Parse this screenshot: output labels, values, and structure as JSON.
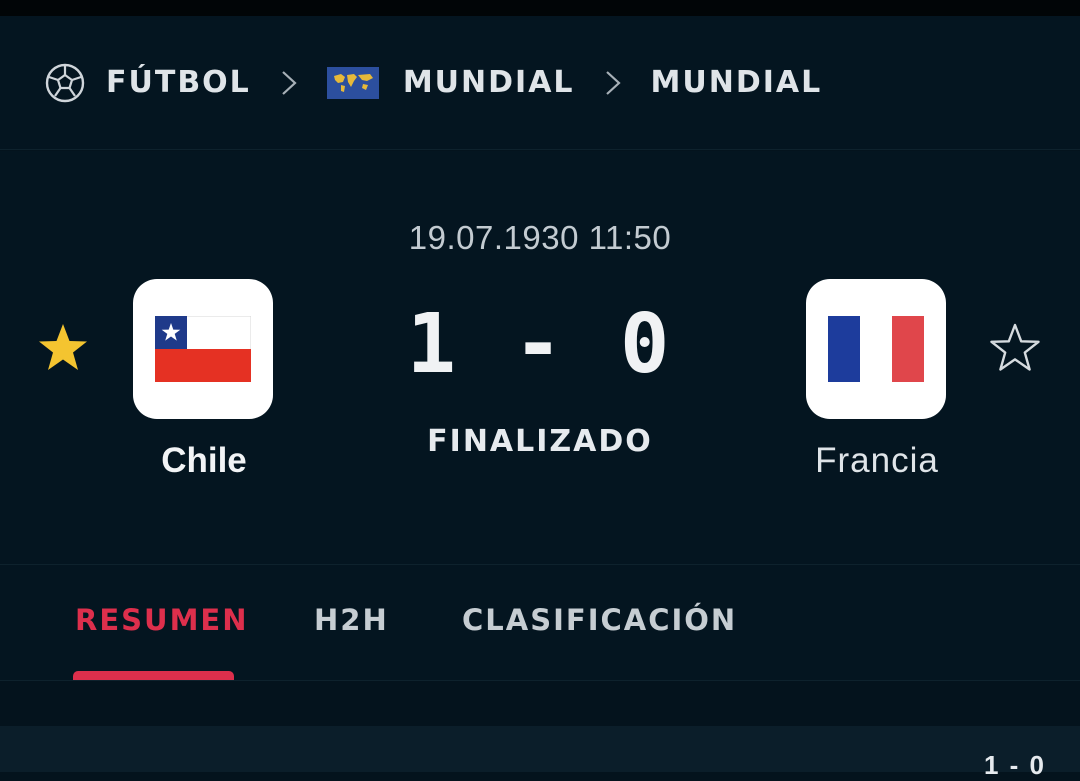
{
  "breadcrumb": {
    "sport": "FÚTBOL",
    "competition": "MUNDIAL",
    "tournament": "MUNDIAL",
    "icons": [
      "soccer-ball-icon",
      "chevron-right-icon",
      "world-flag-icon"
    ]
  },
  "match": {
    "datetime": "19.07.1930 11:50",
    "score": "1 - 0",
    "status": "FINALIZADO",
    "home": {
      "name": "Chile",
      "favorited": true
    },
    "away": {
      "name": "Francia",
      "favorited": false
    }
  },
  "tabs": [
    {
      "label": "RESUMEN",
      "active": true
    },
    {
      "label": "H2H",
      "active": false
    },
    {
      "label": "CLASIFICACIÓN",
      "active": false
    }
  ],
  "summary": {
    "partial_score": "1 - 0"
  },
  "colors": {
    "accent": "#dd2f4c",
    "background": "#04131d",
    "star_active": "#f4c430"
  }
}
